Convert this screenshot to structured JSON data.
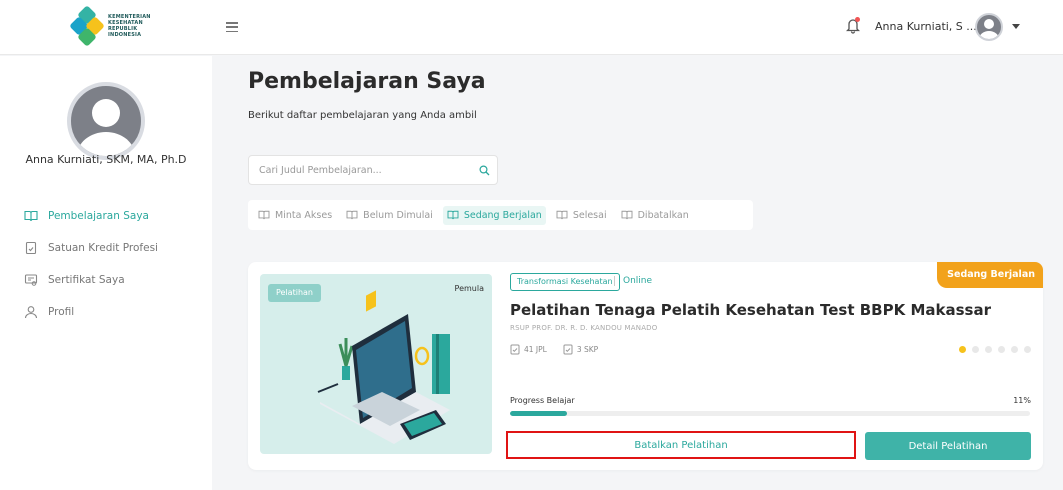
{
  "header": {
    "logo_text": "KEMENTERIAN KESEHATAN REPUBLIK INDONESIA",
    "user_name": "Anna Kurniati, S ..."
  },
  "sidebar": {
    "user_name": "Anna Kurniati, SKM, MA, Ph.D",
    "items": [
      {
        "label": "Pembelajaran Saya",
        "icon": "book-open-icon",
        "active": true
      },
      {
        "label": "Satuan Kredit Profesi",
        "icon": "document-icon",
        "active": false
      },
      {
        "label": "Sertifikat Saya",
        "icon": "certificate-icon",
        "active": false
      },
      {
        "label": "Profil",
        "icon": "user-icon",
        "active": false
      }
    ]
  },
  "main": {
    "title": "Pembelajaran Saya",
    "subtitle": "Berikut daftar pembelajaran yang Anda ambil",
    "search_placeholder": "Cari Judul Pembelajaran...",
    "tabs": [
      {
        "label": "Minta Akses",
        "active": false
      },
      {
        "label": "Belum Dimulai",
        "active": false
      },
      {
        "label": "Sedang Berjalan",
        "active": true
      },
      {
        "label": "Selesai",
        "active": false
      },
      {
        "label": "Dibatalkan",
        "active": false
      }
    ]
  },
  "course": {
    "type_badge": "Pelatihan",
    "level": "Pemula",
    "topic": "Transformasi Kesehatan",
    "mode": "Online",
    "status": "Sedang Berjalan",
    "title": "Pelatihan Tenaga Pelatih Kesehatan Test BBPK Makassar",
    "organizer": "RSUP PROF. DR. R. D. KANDOU MANADO",
    "jpl": "41 JPL",
    "skp": "3 SKP",
    "rating_filled": 1,
    "rating_total": 6,
    "progress_label": "Progress Belajar",
    "progress_value": "11%",
    "progress_fraction": 0.11,
    "cancel_label": "Batalkan Pelatihan",
    "detail_label": "Detail Pelatihan"
  },
  "colors": {
    "accent": "#2ba89d",
    "status": "#f2a21b",
    "highlight_border": "#e01414"
  }
}
